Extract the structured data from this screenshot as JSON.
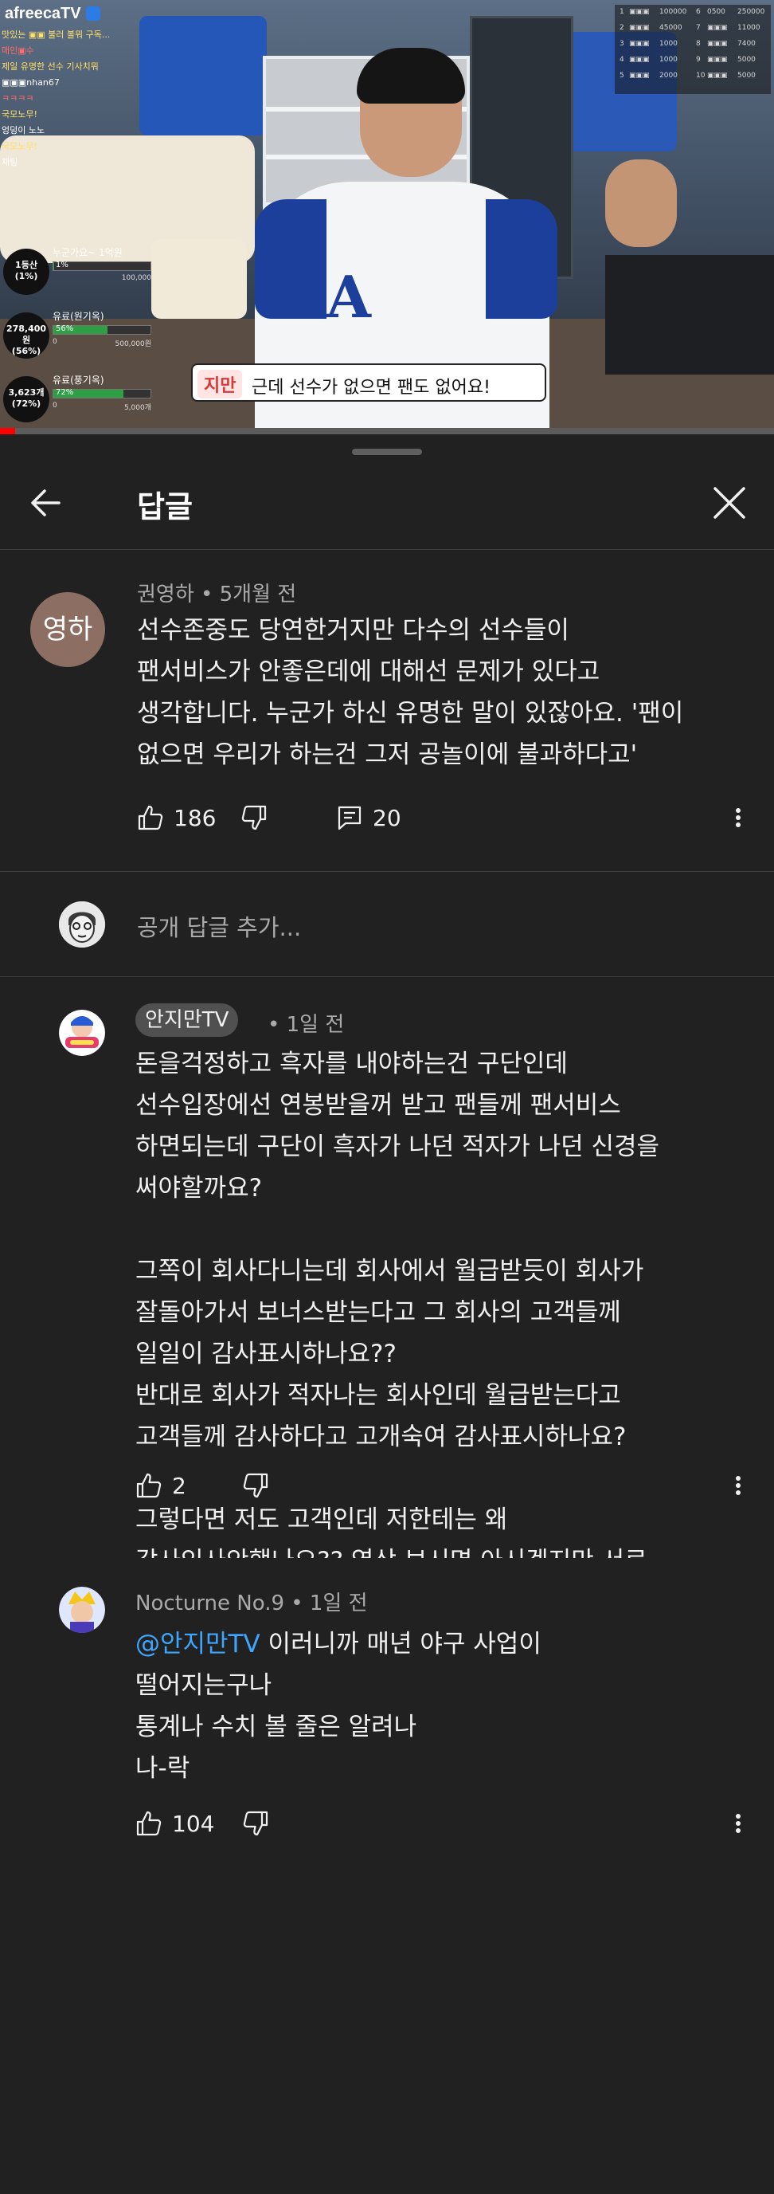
{
  "video": {
    "overlay": {
      "logo": "afreecaTV",
      "lines": [
        "맛있는 ▣▣ 불러 볼뭐 구독...",
        "매인▣수",
        "제일 유명한 선수 기사치뭐",
        "▣▣▣nhan67",
        "ㅋㅋㅋㅋ",
        "국모노무!",
        "엉덩이 노노",
        "국모노무!",
        "채팅"
      ]
    },
    "stats": [
      {
        "circle": "1등산\n(1%)",
        "title": "누군가요~ 1억원",
        "percent": "1%",
        "fill_fraction": 0.01,
        "range_left": "",
        "range_right": "100,000"
      },
      {
        "circle": "278,400원\n(56%)",
        "title": "유료(원기옥)",
        "percent": "56%",
        "fill_fraction": 0.56,
        "range_left": "0",
        "range_right": "500,000원"
      },
      {
        "circle": "3,623개\n(72%)",
        "title": "유료(풍기옥)",
        "percent": "72%",
        "fill_fraction": 0.72,
        "range_left": "0",
        "range_right": "5,000개"
      }
    ],
    "scoreboard": [
      [
        "1",
        "▣▣▣",
        "100000",
        "6",
        "0500",
        "250000"
      ],
      [
        "2",
        "▣▣▣",
        "45000",
        "7",
        "▣▣▣",
        "11000"
      ],
      [
        "3",
        "▣▣▣",
        "1000",
        "8",
        "▣▣▣",
        "7400"
      ],
      [
        "4",
        "▣▣▣",
        "1000",
        "9",
        "▣▣▣",
        "5000"
      ],
      [
        "5",
        "▣▣▣",
        "2000",
        "10",
        "▣▣▣",
        "5000"
      ]
    ],
    "subtitle": {
      "speaker": "지만",
      "text": "근데 선수가 없으면 팬도 없어요!"
    },
    "progress_fraction": 0.02
  },
  "panel": {
    "title": "답글",
    "back_icon": "arrow-back-icon",
    "close_icon": "close-icon"
  },
  "root_comment": {
    "avatar_text": "영하",
    "author": "권영하",
    "time": "5개월 전",
    "meta": "권영하 • 5개월 전",
    "body": "선수존중도 당연한거지만 다수의 선수들이\n팬서비스가 안좋은데에 대해선 문제가 있다고\n생각합니다. 누군가 하신 유명한 말이 있잖아요. '팬이\n없으면 우리가 하는건 그저 공놀이에 불과하다고'",
    "likes": "186",
    "replies": "20"
  },
  "reply_input": {
    "placeholder": "공개 답글 추가..."
  },
  "replies": [
    {
      "author": "안지만TV",
      "time": "• 1일 전",
      "body": "돈을걱정하고 흑자를 내야하는건 구단인데\n선수입장에선 연봉받을꺼 받고 팬들께 팬서비스\n하면되는데 구단이 흑자가 나던 적자가 나던 신경을\n써야할까요?\n\n그쪽이 회사다니는데 회사에서 월급받듯이 회사가\n잘돌아가서 보너스받는다고 그 회사의 고객들께\n일일이 감사표시하나요??\n반대로 회사가 적자나는 회사인데 월급받는다고\n고객들께 감사하다고 고개숙여 감사표시하나요?\n\n그렇다면 저도 고객인데 저한테는 왜\n감사인사안했나요?? 영상 보시면 아시겠지만 서로\n상부상조 해야된다고 취지이고 갑질은 나쁜거다\n입니다\n\n영상을 다보시고 댓글달아주세요 억까하지마시구요\n그러다 벌받아요",
      "likes": "2"
    },
    {
      "author_meta": "Nocturne No.9 • 1일 전",
      "mention": "@안지만TV",
      "first_line_rest": " 이러니까 매년 야구 사업이",
      "body_rest": "떨어지는구나\n통계나 수치 볼 줄은 알려나\n나-락",
      "likes": "104"
    }
  ],
  "colors": {
    "panel_bg": "#212121",
    "text_primary": "#f1f1f1",
    "text_secondary": "#aaaaaa",
    "mention": "#3ea6ff",
    "chip_bg": "#505050",
    "progress": "#ff0000"
  }
}
